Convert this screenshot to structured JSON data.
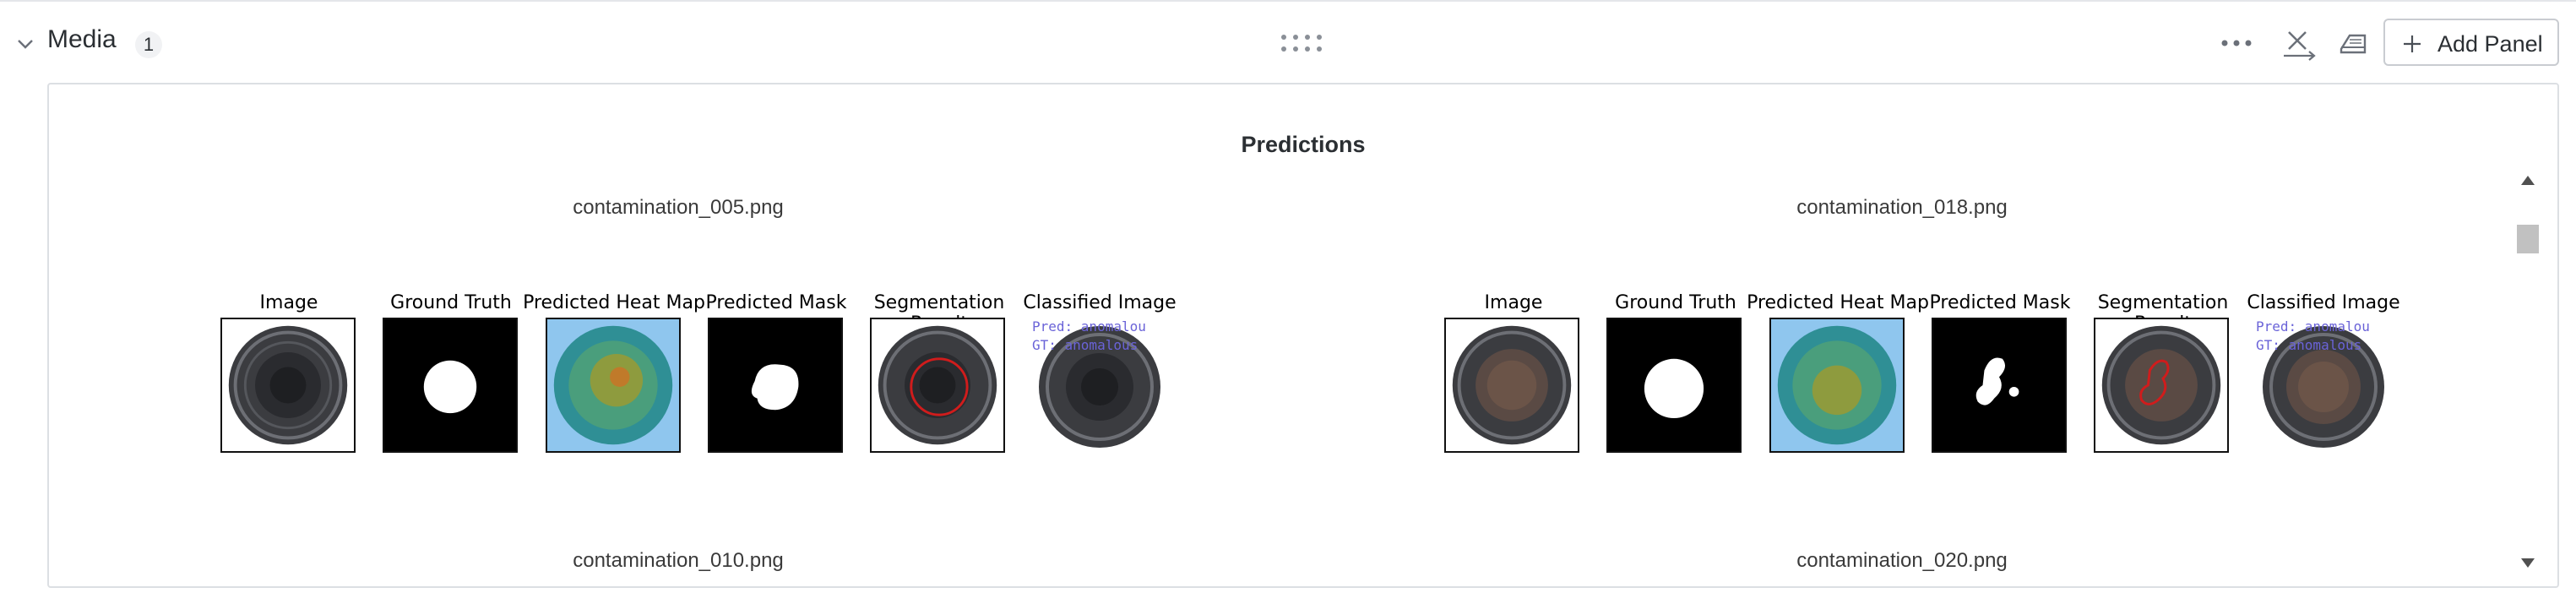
{
  "section": {
    "title": "Media",
    "count": "1"
  },
  "toolbar": {
    "add_panel_label": "Add Panel"
  },
  "panel": {
    "title": "Predictions"
  },
  "columns": [
    "Image",
    "Ground Truth",
    "Predicted Heat Map",
    "Predicted Mask",
    "Segmentation Result",
    "Classified Image"
  ],
  "samples": [
    {
      "filename": "contamination_005.png",
      "pred_label": "Pred: anomalou",
      "gt_label": "GT: anomalous"
    },
    {
      "filename": "contamination_018.png",
      "pred_label": "Pred: anomalou",
      "gt_label": "GT: anomalous"
    }
  ],
  "next_samples": [
    {
      "filename": "contamination_010.png"
    },
    {
      "filename": "contamination_020.png"
    }
  ],
  "colors": {
    "pred_text": "#6a63d8",
    "heatmap_bg": "#8fc6ee",
    "segmentation_outline": "#d01c1c"
  },
  "icons": [
    "chevron-down-icon",
    "drag-handle-icon",
    "more-icon",
    "function-icon",
    "eraser-icon",
    "plus-icon"
  ]
}
